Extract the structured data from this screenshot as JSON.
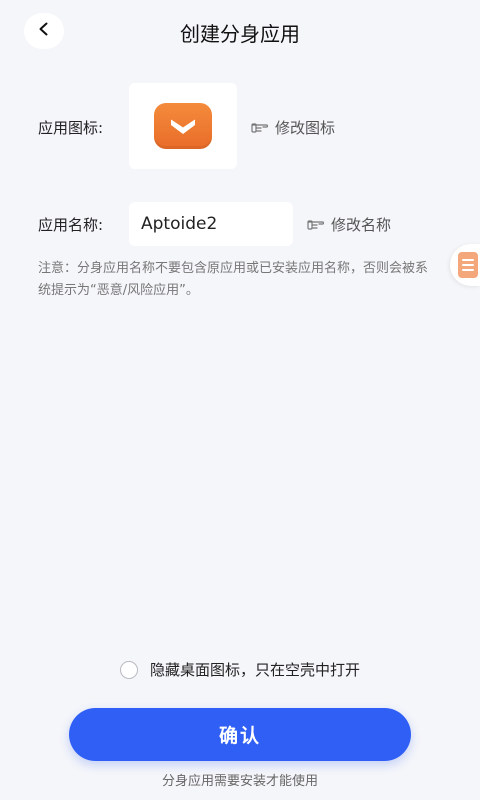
{
  "header": {
    "title": "创建分身应用",
    "back_icon": "chevron-left-icon"
  },
  "icon_row": {
    "label": "应用图标:",
    "app_icon": "aptoide-logo-icon",
    "app_icon_color": "#ee7a30",
    "edit_label": "修改图标"
  },
  "name_row": {
    "label": "应用名称:",
    "value": "Aptoide2",
    "edit_label": "修改名称"
  },
  "note": "注意：分身应用名称不要包含原应用或已安装应用名称，否则会被系统提示为“恶意/风险应用”。",
  "side_tab": {
    "icon": "document-icon"
  },
  "hide_option": {
    "label": "隐藏桌面图标，只在空壳中打开",
    "checked": false
  },
  "confirm_label": "确认",
  "footer_note": "分身应用需要安装才能使用",
  "colors": {
    "primary": "#2f5ff5",
    "background": "#f5f6fa"
  }
}
